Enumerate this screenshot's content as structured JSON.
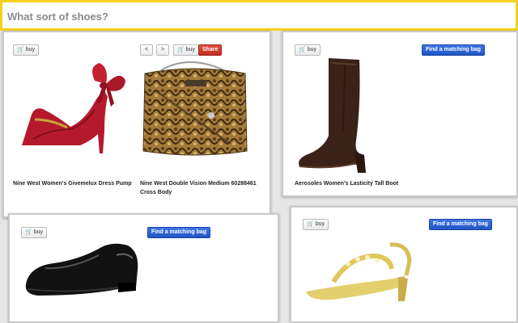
{
  "search": {
    "placeholder": "What sort of shoes?",
    "value": ""
  },
  "icons": {
    "cart": "shopping-cart-icon",
    "prev": "chevron-left-icon",
    "next": "chevron-right-icon"
  },
  "colors": {
    "primary": "#2a5fd4",
    "danger": "#d23b2e",
    "search_border": "#f2d21b"
  },
  "buttons": {
    "buy": "buy",
    "find_bag": "Find a matching bag",
    "share": "Share",
    "prev": "<",
    "next": ">"
  },
  "cards": [
    {
      "products": [
        {
          "name": "Nine West Women's Givemelux Dress Pump",
          "image": "red-dress-pump-image"
        },
        {
          "name_line1": "Nine West Double Vision Medium 60288461",
          "name_line2": "Cross Body",
          "image": "snakeskin-cross-body-bag-image"
        }
      ]
    },
    {
      "products": [
        {
          "name": "Aerosoles Women's Lasticity Tall Boot",
          "image": "brown-tall-boot-image"
        }
      ]
    },
    {
      "products": [
        {
          "name": "",
          "image": "black-patent-loafer-image"
        }
      ]
    },
    {
      "products": [
        {
          "name": "",
          "image": "gold-jeweled-sandal-image"
        }
      ]
    }
  ]
}
